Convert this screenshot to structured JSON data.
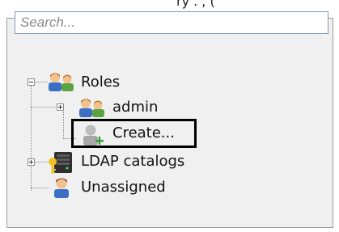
{
  "caption": "ry . , (",
  "search": {
    "placeholder": "Search..."
  },
  "tree": {
    "roles_label": "Roles",
    "admin_label": "admin",
    "create_label": "Create...",
    "ldap_label": "LDAP catalogs",
    "unassigned_label": "Unassigned"
  }
}
